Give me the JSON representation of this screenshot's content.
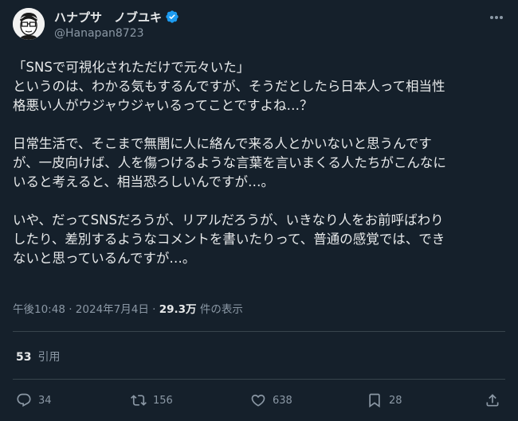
{
  "user": {
    "display_name": "ハナプサ　ノブユキ",
    "handle": "@Hanapan8723",
    "verified": true,
    "avatar_icon": "cartoon-avatar-with-glasses"
  },
  "tweet": {
    "paragraphs": [
      [
        "「SNSで可視化されただけで元々いた」",
        "というのは、わかる気もするんですが、そうだとしたら日本人って相当性",
        "格悪い人がウジャウジャいるってことですよね…？"
      ],
      [
        "日常生活で、そこまで無闇に人に絡んで来る人とかいないと思うんです",
        "が、一皮向けば、人を傷つけるような言葉を言いまくる人たちがこんなに",
        "いると考えると、相当恐ろしいんですが…。"
      ],
      [
        "いや、だってSNSだろうが、リアルだろうが、いきなり人をお前呼ばわり",
        "したり、差別するようなコメントを書いたりって、普通の感覚では、でき",
        "ないと思っているんですが…。"
      ]
    ],
    "time": "午後10:48",
    "date": "2024年7月4日",
    "views_count": "29.3万",
    "views_label": "件の表示"
  },
  "quotes": {
    "count": "53",
    "label": "引用"
  },
  "actions": {
    "replies": "34",
    "reposts": "156",
    "likes": "638",
    "bookmarks": "28"
  },
  "colors": {
    "background": "#15202b",
    "text": "#e7e9ea",
    "muted": "#8b98a5",
    "divider": "#38444d",
    "verified": "#1d9bf0"
  }
}
